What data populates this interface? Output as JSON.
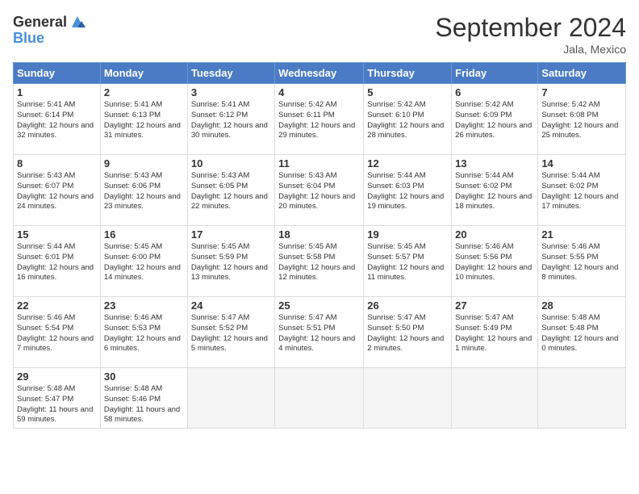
{
  "logo": {
    "general": "General",
    "blue": "Blue"
  },
  "title": "September 2024",
  "location": "Jala, Mexico",
  "days_of_week": [
    "Sunday",
    "Monday",
    "Tuesday",
    "Wednesday",
    "Thursday",
    "Friday",
    "Saturday"
  ],
  "weeks": [
    [
      {
        "day": "1",
        "sunrise": "5:41 AM",
        "sunset": "6:14 PM",
        "daylight": "12 hours and 32 minutes."
      },
      {
        "day": "2",
        "sunrise": "5:41 AM",
        "sunset": "6:13 PM",
        "daylight": "12 hours and 31 minutes."
      },
      {
        "day": "3",
        "sunrise": "5:41 AM",
        "sunset": "6:12 PM",
        "daylight": "12 hours and 30 minutes."
      },
      {
        "day": "4",
        "sunrise": "5:42 AM",
        "sunset": "6:11 PM",
        "daylight": "12 hours and 29 minutes."
      },
      {
        "day": "5",
        "sunrise": "5:42 AM",
        "sunset": "6:10 PM",
        "daylight": "12 hours and 28 minutes."
      },
      {
        "day": "6",
        "sunrise": "5:42 AM",
        "sunset": "6:09 PM",
        "daylight": "12 hours and 26 minutes."
      },
      {
        "day": "7",
        "sunrise": "5:42 AM",
        "sunset": "6:08 PM",
        "daylight": "12 hours and 25 minutes."
      }
    ],
    [
      {
        "day": "8",
        "sunrise": "5:43 AM",
        "sunset": "6:07 PM",
        "daylight": "12 hours and 24 minutes."
      },
      {
        "day": "9",
        "sunrise": "5:43 AM",
        "sunset": "6:06 PM",
        "daylight": "12 hours and 23 minutes."
      },
      {
        "day": "10",
        "sunrise": "5:43 AM",
        "sunset": "6:05 PM",
        "daylight": "12 hours and 22 minutes."
      },
      {
        "day": "11",
        "sunrise": "5:43 AM",
        "sunset": "6:04 PM",
        "daylight": "12 hours and 20 minutes."
      },
      {
        "day": "12",
        "sunrise": "5:44 AM",
        "sunset": "6:03 PM",
        "daylight": "12 hours and 19 minutes."
      },
      {
        "day": "13",
        "sunrise": "5:44 AM",
        "sunset": "6:02 PM",
        "daylight": "12 hours and 18 minutes."
      },
      {
        "day": "14",
        "sunrise": "5:44 AM",
        "sunset": "6:02 PM",
        "daylight": "12 hours and 17 minutes."
      }
    ],
    [
      {
        "day": "15",
        "sunrise": "5:44 AM",
        "sunset": "6:01 PM",
        "daylight": "12 hours and 16 minutes."
      },
      {
        "day": "16",
        "sunrise": "5:45 AM",
        "sunset": "6:00 PM",
        "daylight": "12 hours and 14 minutes."
      },
      {
        "day": "17",
        "sunrise": "5:45 AM",
        "sunset": "5:59 PM",
        "daylight": "12 hours and 13 minutes."
      },
      {
        "day": "18",
        "sunrise": "5:45 AM",
        "sunset": "5:58 PM",
        "daylight": "12 hours and 12 minutes."
      },
      {
        "day": "19",
        "sunrise": "5:45 AM",
        "sunset": "5:57 PM",
        "daylight": "12 hours and 11 minutes."
      },
      {
        "day": "20",
        "sunrise": "5:46 AM",
        "sunset": "5:56 PM",
        "daylight": "12 hours and 10 minutes."
      },
      {
        "day": "21",
        "sunrise": "5:46 AM",
        "sunset": "5:55 PM",
        "daylight": "12 hours and 8 minutes."
      }
    ],
    [
      {
        "day": "22",
        "sunrise": "5:46 AM",
        "sunset": "5:54 PM",
        "daylight": "12 hours and 7 minutes."
      },
      {
        "day": "23",
        "sunrise": "5:46 AM",
        "sunset": "5:53 PM",
        "daylight": "12 hours and 6 minutes."
      },
      {
        "day": "24",
        "sunrise": "5:47 AM",
        "sunset": "5:52 PM",
        "daylight": "12 hours and 5 minutes."
      },
      {
        "day": "25",
        "sunrise": "5:47 AM",
        "sunset": "5:51 PM",
        "daylight": "12 hours and 4 minutes."
      },
      {
        "day": "26",
        "sunrise": "5:47 AM",
        "sunset": "5:50 PM",
        "daylight": "12 hours and 2 minutes."
      },
      {
        "day": "27",
        "sunrise": "5:47 AM",
        "sunset": "5:49 PM",
        "daylight": "12 hours and 1 minute."
      },
      {
        "day": "28",
        "sunrise": "5:48 AM",
        "sunset": "5:48 PM",
        "daylight": "12 hours and 0 minutes."
      }
    ],
    [
      {
        "day": "29",
        "sunrise": "5:48 AM",
        "sunset": "5:47 PM",
        "daylight": "11 hours and 59 minutes."
      },
      {
        "day": "30",
        "sunrise": "5:48 AM",
        "sunset": "5:46 PM",
        "daylight": "11 hours and 58 minutes."
      },
      null,
      null,
      null,
      null,
      null
    ]
  ]
}
